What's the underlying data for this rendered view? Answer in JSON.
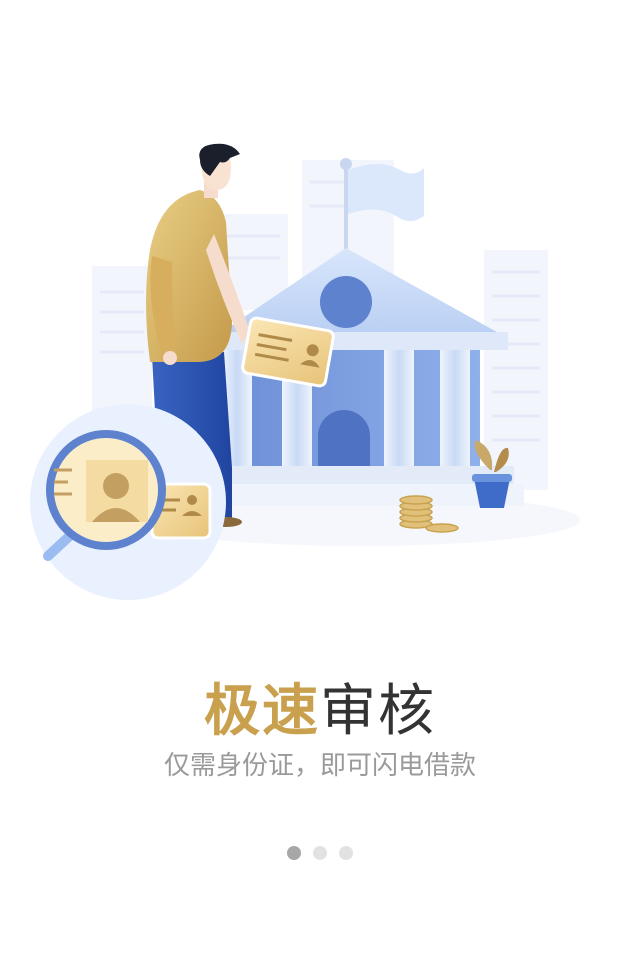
{
  "onboarding": {
    "title_accent": "极速",
    "title_plain": "审核",
    "subtitle": "仅需身份证，即可闪电借款"
  },
  "pagination": {
    "total": 3,
    "active": 1
  },
  "colors": {
    "accent": "#c9a14e",
    "title_text": "#333333",
    "subtitle_text": "#9a9a9a",
    "dot_active": "#a7a7a7",
    "dot_inactive": "#e2e2e2"
  }
}
